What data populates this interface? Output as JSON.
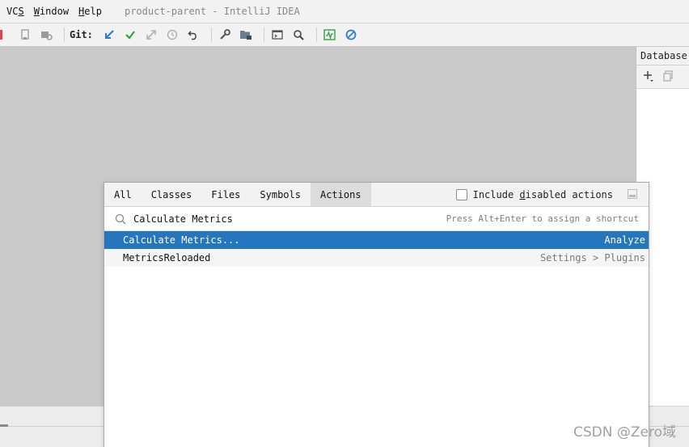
{
  "menubar": {
    "items": [
      {
        "label": "VCS",
        "mnemonic_index": 2
      },
      {
        "label": "Window",
        "mnemonic_index": 0
      },
      {
        "label": "Help",
        "mnemonic_index": 0
      }
    ],
    "window_title": "product-parent - IntelliJ IDEA"
  },
  "toolbar": {
    "git_label": "Git:",
    "icons": [
      "device-icon",
      "device-settings-icon",
      "update-project-icon",
      "commit-icon",
      "compare-icon",
      "history-icon",
      "rollback-icon",
      "wrench-icon",
      "project-structure-icon",
      "terminal-icon",
      "search-icon",
      "monitor-icon",
      "no-entry-icon"
    ],
    "accent_blue": "#2f7ad6",
    "accent_green": "#33a146"
  },
  "right_panel": {
    "title": "Database",
    "tools": [
      "add-icon",
      "copy-icon"
    ]
  },
  "popup": {
    "tabs": [
      "All",
      "Classes",
      "Files",
      "Symbols",
      "Actions"
    ],
    "active_tab": "Actions",
    "include_label_pre": "Include ",
    "include_label_mnemonic": "d",
    "include_label_post": "isabled actions",
    "include_checked": false,
    "search_value": "Calculate Metrics",
    "search_hint": "Press Alt+Enter to assign a shortcut",
    "results": [
      {
        "name": "Calculate Metrics...",
        "category": "Analyze",
        "selected": true
      },
      {
        "name": "MetricsReloaded",
        "category": "Settings > Plugins",
        "selected": false
      }
    ],
    "selection_color": "#2675bf"
  },
  "watermark": "CSDN @Zero域"
}
